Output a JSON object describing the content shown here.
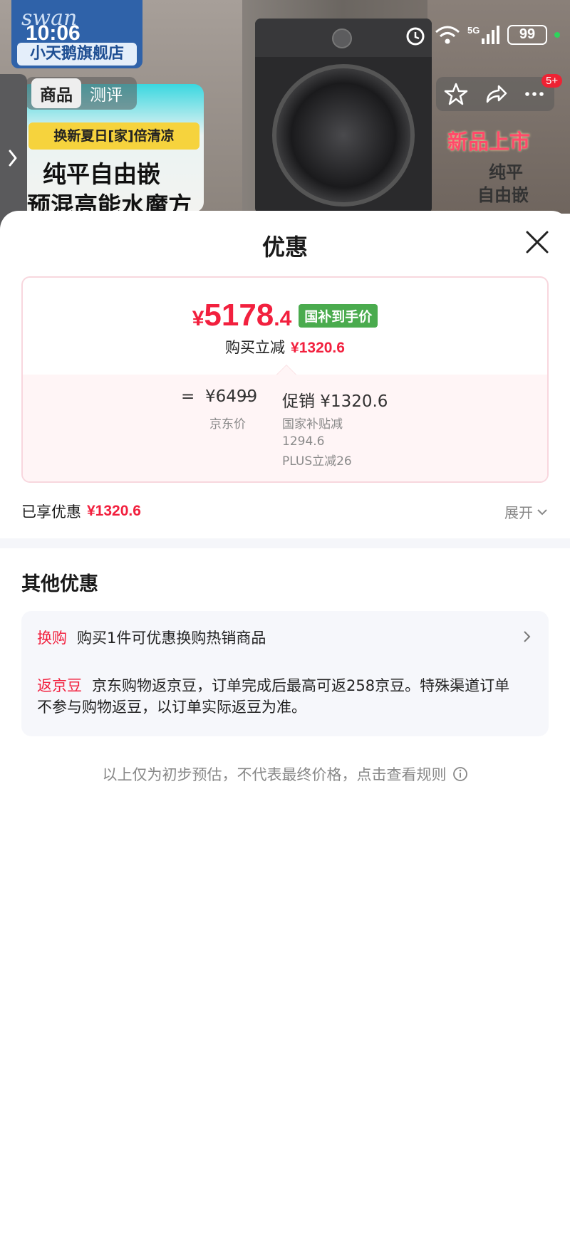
{
  "status_bar": {
    "time": "10:06",
    "battery": "99",
    "network": "5G"
  },
  "banner": {
    "store_name": "小天鹅旗舰店",
    "logo_text": "swan",
    "tabs": [
      {
        "label": "商品"
      },
      {
        "label": "测评"
      }
    ],
    "promo_strip": "换新夏日[家]倍清凉",
    "promo_line1": "纯平自由嵌",
    "promo_line2": "预混高能水魔方",
    "deco_1": "新品上市",
    "deco_2": "纯平",
    "deco_3": "自由嵌",
    "badge": "5+"
  },
  "sheet": {
    "title": "优惠",
    "price": {
      "currency": "¥",
      "integer": "5178",
      "decimal": ".4",
      "tag": "国补到手价"
    },
    "reduce_label": "购买立减",
    "reduce_amount": "¥1320.6",
    "formula": {
      "equals": "=",
      "jd_price": "¥6499",
      "minus": "−",
      "promo": "促销 ¥1320.6",
      "jd_price_label": "京东价",
      "sub_1": "国家补贴减",
      "sub_1_amount": "1294.6",
      "sub_2": "PLUS立减26"
    },
    "enjoyed_label": "已享优惠",
    "enjoyed_amount": "¥1320.6",
    "expand_label": "展开",
    "other_title": "其他优惠",
    "other_items": [
      {
        "tag": "换购",
        "text": "购买1件可优惠换购热销商品"
      },
      {
        "tag": "返京豆",
        "text": "京东购物返京豆，订单完成后最高可返258京豆。特殊渠道订单不参与购物返豆，以订单实际返豆为准。"
      }
    ],
    "footnote": "以上仅为初步预估，不代表最终价格，点击查看规则"
  },
  "colors": {
    "accent_red": "#f2203e",
    "tag_green": "#4aab4e"
  }
}
